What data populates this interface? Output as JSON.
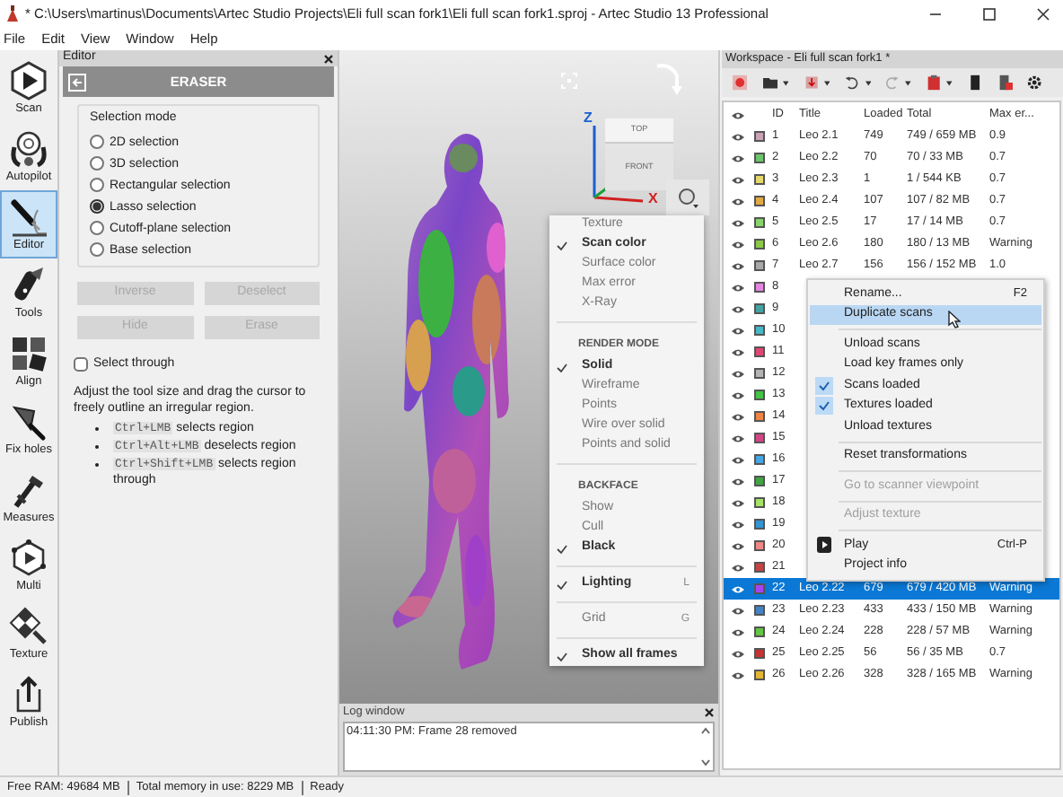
{
  "window": {
    "title": "* C:\\Users\\martinus\\Documents\\Artec Studio Projects\\Eli full scan fork1\\Eli full scan fork1.sproj - Artec Studio 13 Professional"
  },
  "menu": [
    "File",
    "Edit",
    "View",
    "Window",
    "Help"
  ],
  "toolbar": [
    {
      "kind": "scan",
      "label": "Scan",
      "selected": false
    },
    {
      "kind": "autopilot",
      "label": "Autopilot",
      "selected": false
    },
    {
      "kind": "editor",
      "label": "Editor",
      "selected": true
    },
    {
      "kind": "tools",
      "label": "Tools",
      "selected": false
    },
    {
      "kind": "align",
      "label": "Align",
      "selected": false
    },
    {
      "kind": "fix_holes",
      "label": "Fix holes",
      "selected": false
    },
    {
      "kind": "measures",
      "label": "Measures",
      "selected": false
    },
    {
      "kind": "multi",
      "label": "Multi",
      "selected": false
    },
    {
      "kind": "texture",
      "label": "Texture",
      "selected": false
    },
    {
      "kind": "publish",
      "label": "Publish",
      "selected": false
    }
  ],
  "editor": {
    "title": "Editor",
    "header": "ERASER",
    "group_title": "Selection mode",
    "modes": [
      {
        "label": "2D selection",
        "selected": false
      },
      {
        "label": "3D selection",
        "selected": false
      },
      {
        "label": "Rectangular selection",
        "selected": false
      },
      {
        "label": "Lasso selection",
        "selected": true
      },
      {
        "label": "Cutoff-plane selection",
        "selected": false
      },
      {
        "label": "Base selection",
        "selected": false
      }
    ],
    "buttons": [
      {
        "label": "Inverse",
        "disabled": true
      },
      {
        "label": "Deselect",
        "disabled": true
      },
      {
        "label": "Hide",
        "disabled": true
      },
      {
        "label": "Erase",
        "disabled": true
      }
    ],
    "select_through": {
      "label": "Select through",
      "checked": false
    },
    "hint": "Adjust the tool size and drag the cursor to freely outline an irregular region.",
    "shortcuts": [
      {
        "keys": "Ctrl+LMB",
        "text": "selects region"
      },
      {
        "keys": "Ctrl+Alt+LMB",
        "text": "deselects region"
      },
      {
        "keys": "Ctrl+Shift+LMB",
        "text": "selects region through"
      }
    ]
  },
  "viewport": {
    "cube": {
      "top": "TOP",
      "front": "FRONT"
    },
    "axes": [
      "Z",
      "X"
    ],
    "menu": [
      {
        "kind": "item",
        "label": "Texture",
        "checked": false
      },
      {
        "kind": "item",
        "label": "Scan color",
        "checked": true
      },
      {
        "kind": "item",
        "label": "Surface color",
        "checked": false
      },
      {
        "kind": "item",
        "label": "Max error",
        "checked": false
      },
      {
        "kind": "item",
        "label": "X-Ray",
        "checked": false
      },
      {
        "kind": "separator"
      },
      {
        "kind": "header",
        "label": "RENDER MODE"
      },
      {
        "kind": "item",
        "label": "Solid",
        "checked": true
      },
      {
        "kind": "item",
        "label": "Wireframe",
        "checked": false
      },
      {
        "kind": "item",
        "label": "Points",
        "checked": false
      },
      {
        "kind": "item",
        "label": "Wire over solid",
        "checked": false
      },
      {
        "kind": "item",
        "label": "Points and solid",
        "checked": false
      },
      {
        "kind": "separator"
      },
      {
        "kind": "header",
        "label": "BACKFACE"
      },
      {
        "kind": "item",
        "label": "Show",
        "checked": false
      },
      {
        "kind": "item",
        "label": "Cull",
        "checked": false
      },
      {
        "kind": "item",
        "label": "Black",
        "checked": true
      },
      {
        "kind": "separator"
      },
      {
        "kind": "item",
        "label": "Lighting",
        "checked": true,
        "shortcut": "L"
      },
      {
        "kind": "separator"
      },
      {
        "kind": "item",
        "label": "Grid",
        "checked": false,
        "shortcut": "G"
      },
      {
        "kind": "separator"
      },
      {
        "kind": "item",
        "label": "Show all frames",
        "checked": true
      }
    ]
  },
  "log": {
    "title": "Log window",
    "lines": [
      "04:11:30 PM: Frame 28 removed"
    ]
  },
  "workspace": {
    "title": "Workspace - Eli full scan fork1 *",
    "columns": [
      "ID",
      "Title",
      "Loaded",
      "Total",
      "Max er..."
    ],
    "rows": [
      {
        "id": "1",
        "color": "#c9a2b4",
        "title": "Leo 2.1",
        "loaded": "749",
        "total": "749 / 659 MB",
        "max_error": "0.9",
        "selected": false
      },
      {
        "id": "2",
        "color": "#6cc46c",
        "title": "Leo 2.2",
        "loaded": "70",
        "total": "70 / 33 MB",
        "max_error": "0.7",
        "selected": false
      },
      {
        "id": "3",
        "color": "#e6d86a",
        "title": "Leo 2.3",
        "loaded": "1",
        "total": "1 / 544 KB",
        "max_error": "0.7",
        "selected": false
      },
      {
        "id": "4",
        "color": "#e2aa44",
        "title": "Leo 2.4",
        "loaded": "107",
        "total": "107 / 82 MB",
        "max_error": "0.7",
        "selected": false
      },
      {
        "id": "5",
        "color": "#86d46a",
        "title": "Leo 2.5",
        "loaded": "17",
        "total": "17 / 14 MB",
        "max_error": "0.7",
        "selected": false
      },
      {
        "id": "6",
        "color": "#8cc848",
        "title": "Leo 2.6",
        "loaded": "180",
        "total": "180 / 13 MB",
        "max_error": "Warning",
        "selected": false
      },
      {
        "id": "7",
        "color": "#a8a8a8",
        "title": "Leo 2.7",
        "loaded": "156",
        "total": "156 / 152 MB",
        "max_error": "1.0",
        "selected": false
      },
      {
        "id": "8",
        "color": "#e486e0",
        "selected": false
      },
      {
        "id": "9",
        "color": "#44a4a4",
        "selected": false
      },
      {
        "id": "10",
        "color": "#48b8c8",
        "selected": false
      },
      {
        "id": "11",
        "color": "#e04674",
        "selected": false
      },
      {
        "id": "12",
        "color": "#b4b4b4",
        "selected": false
      },
      {
        "id": "13",
        "color": "#44c444",
        "selected": false
      },
      {
        "id": "14",
        "color": "#f08444",
        "selected": false
      },
      {
        "id": "15",
        "color": "#d44684",
        "selected": false
      },
      {
        "id": "16",
        "color": "#46a6e4",
        "selected": false
      },
      {
        "id": "17",
        "color": "#40a444",
        "selected": false
      },
      {
        "id": "18",
        "color": "#a6e266",
        "selected": false
      },
      {
        "id": "19",
        "color": "#3494d4",
        "selected": false
      },
      {
        "id": "20",
        "color": "#f08686",
        "selected": false
      },
      {
        "id": "21",
        "color": "#c44444",
        "selected": false
      },
      {
        "id": "22",
        "color": "#a444f4",
        "title": "Leo 2.22",
        "loaded": "679",
        "total": "679 / 420 MB",
        "max_error": "Warning",
        "selected": true
      },
      {
        "id": "23",
        "color": "#4484c4",
        "title": "Leo 2.23",
        "loaded": "433",
        "total": "433 / 150 MB",
        "max_error": "Warning",
        "selected": false
      },
      {
        "id": "24",
        "color": "#64c444",
        "title": "Leo 2.24",
        "loaded": "228",
        "total": "228 / 57 MB",
        "max_error": "Warning",
        "selected": false
      },
      {
        "id": "25",
        "color": "#c43434",
        "title": "Leo 2.25",
        "loaded": "56",
        "total": "56 / 35 MB",
        "max_error": "0.7",
        "selected": false
      },
      {
        "id": "26",
        "color": "#e4b434",
        "title": "Leo 2.26",
        "loaded": "328",
        "total": "328 / 165 MB",
        "max_error": "Warning",
        "selected": false
      }
    ]
  },
  "context_menu": [
    {
      "kind": "item",
      "label": "Rename...",
      "shortcut": "F2",
      "highlighted": false,
      "checked": false,
      "disabled": false
    },
    {
      "kind": "item",
      "label": "Duplicate scans",
      "highlighted": true,
      "checked": false,
      "disabled": false
    },
    {
      "kind": "separator"
    },
    {
      "kind": "item",
      "label": "Unload scans",
      "highlighted": false,
      "checked": false,
      "disabled": false
    },
    {
      "kind": "item",
      "label": "Load key frames only",
      "highlighted": false,
      "checked": false,
      "disabled": false
    },
    {
      "kind": "item",
      "label": "Scans loaded",
      "highlighted": false,
      "checked": true,
      "disabled": false
    },
    {
      "kind": "item",
      "label": "Textures loaded",
      "highlighted": false,
      "checked": true,
      "disabled": false
    },
    {
      "kind": "item",
      "label": "Unload textures",
      "highlighted": false,
      "checked": false,
      "disabled": false
    },
    {
      "kind": "separator"
    },
    {
      "kind": "item",
      "label": "Reset transformations",
      "highlighted": false,
      "checked": false,
      "disabled": false
    },
    {
      "kind": "separator"
    },
    {
      "kind": "item",
      "label": "Go to scanner viewpoint",
      "highlighted": false,
      "checked": false,
      "disabled": true
    },
    {
      "kind": "separator"
    },
    {
      "kind": "item",
      "label": "Adjust texture",
      "highlighted": false,
      "checked": false,
      "disabled": true
    },
    {
      "kind": "separator"
    },
    {
      "kind": "play",
      "label": "Play",
      "shortcut": "Ctrl-P",
      "highlighted": false,
      "checked": false,
      "disabled": false
    },
    {
      "kind": "item",
      "label": "Project info",
      "highlighted": false,
      "checked": false,
      "disabled": false
    }
  ],
  "status_bar": [
    "Free RAM: 49684 MB",
    "Total memory in use: 8229 MB",
    "Ready"
  ]
}
